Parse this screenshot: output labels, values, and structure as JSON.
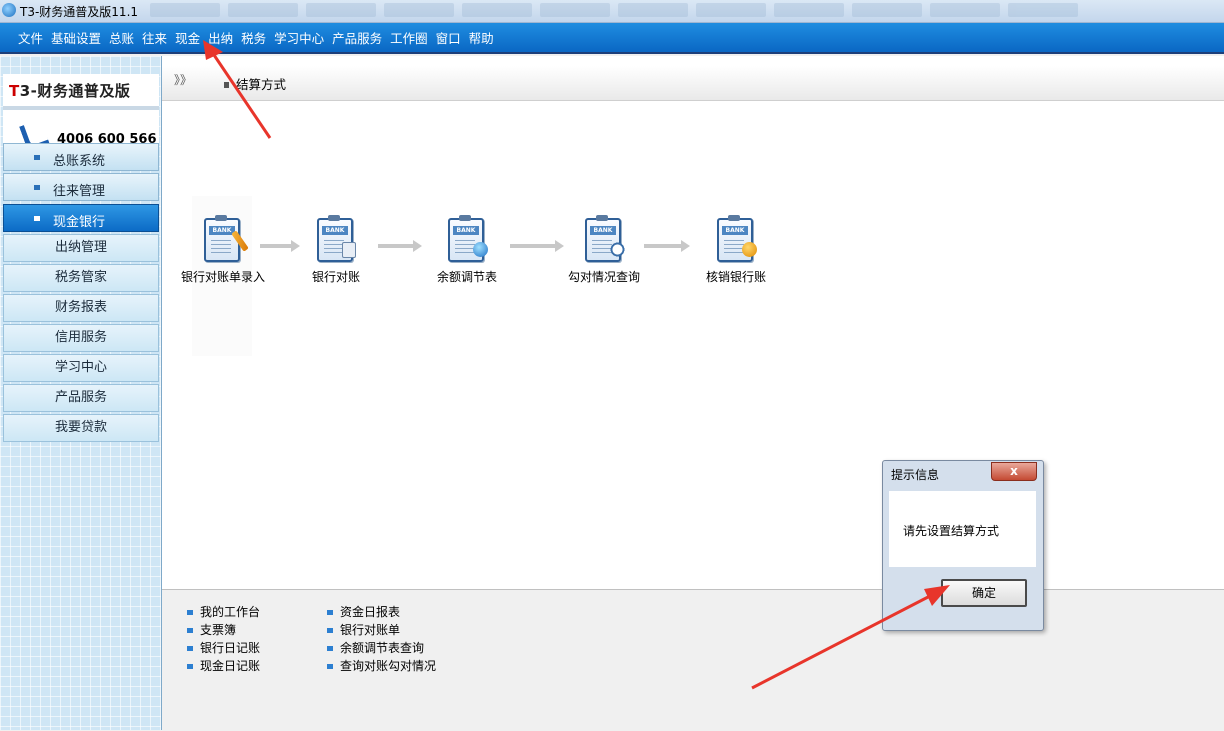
{
  "window": {
    "title": "T3-财务通普及版11.1"
  },
  "menu": [
    "文件",
    "基础设置",
    "总账",
    "往来",
    "现金",
    "出纳",
    "税务",
    "学习中心",
    "产品服务",
    "工作圈",
    "窗口",
    "帮助"
  ],
  "logo": {
    "title_t": "T",
    "title_rest": "3-财务通普及版",
    "phone": "4006 600 566"
  },
  "sidebar": {
    "modules": [
      {
        "label": "总账系统"
      },
      {
        "label": "往来管理"
      },
      {
        "label": "现金银行"
      }
    ],
    "subitems": [
      {
        "label": "出纳管理"
      },
      {
        "label": "税务管家"
      },
      {
        "label": "财务报表"
      },
      {
        "label": "信用服务"
      },
      {
        "label": "学习中心"
      },
      {
        "label": "产品服务"
      },
      {
        "label": "我要贷款"
      }
    ]
  },
  "breadcrumb": {
    "chevron": "》》",
    "label": "结算方式"
  },
  "flow": [
    {
      "label": "银行对账单录入",
      "icon": "bank-clipboard-pen-icon"
    },
    {
      "label": "银行对账",
      "icon": "bank-clipboard-docs-icon"
    },
    {
      "label": "余额调节表",
      "icon": "bank-clipboard-globe-icon"
    },
    {
      "label": "勾对情况查询",
      "icon": "bank-clipboard-magnifier-icon"
    },
    {
      "label": "核销银行账",
      "icon": "bank-clipboard-refresh-icon"
    }
  ],
  "links": {
    "col1": [
      "我的工作台",
      "支票簿",
      "银行日记账",
      "现金日记账"
    ],
    "col2": [
      "资金日报表",
      "银行对账单",
      "余额调节表查询",
      "查询对账勾对情况"
    ]
  },
  "dialog": {
    "title": "提示信息",
    "close_glyph": "x",
    "message": "请先设置结算方式",
    "ok_label": "确定"
  },
  "colors": {
    "menu_bar": "#0a67c4",
    "annotation_arrow": "#e8352b",
    "active_module": "#1a80d6"
  }
}
